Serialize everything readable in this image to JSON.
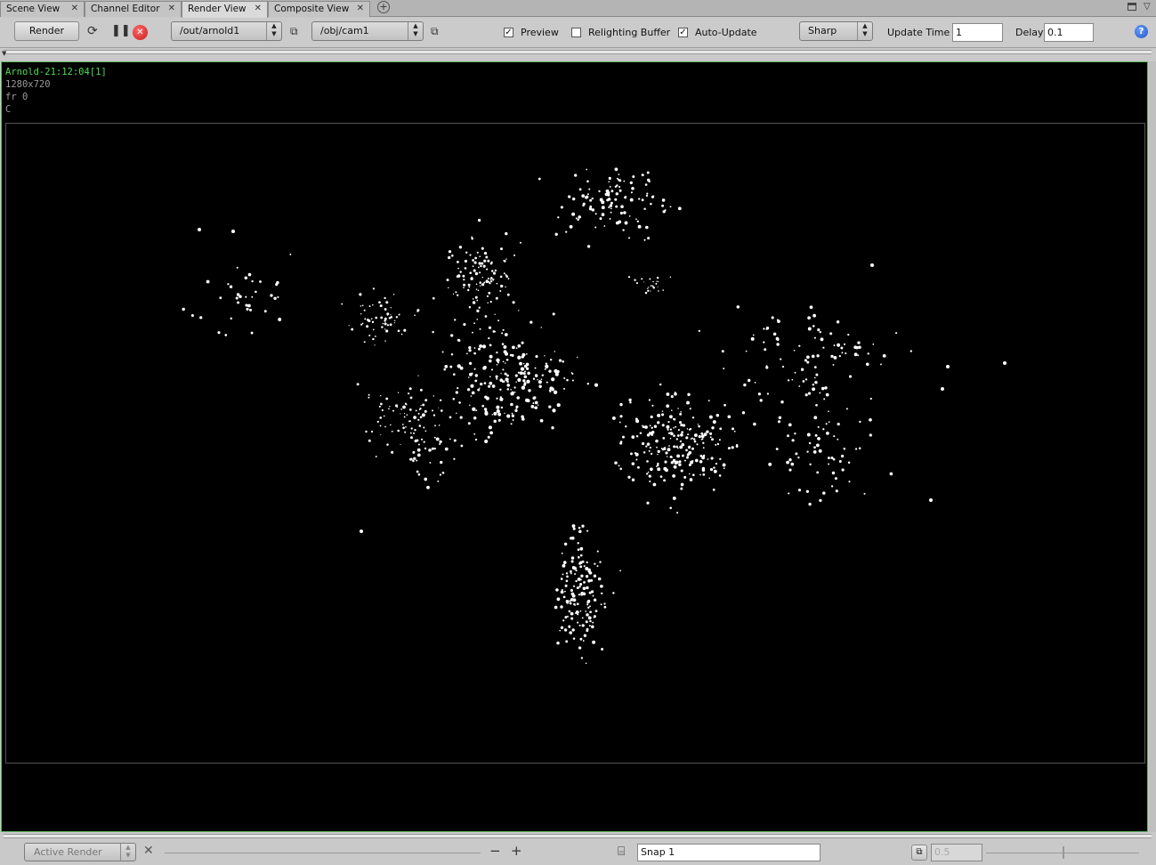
{
  "tabs": [
    {
      "label": "Scene View",
      "active": false
    },
    {
      "label": "Channel Editor",
      "active": false
    },
    {
      "label": "Render View",
      "active": true
    },
    {
      "label": "Composite View",
      "active": false
    }
  ],
  "toolbar": {
    "render_label": "Render",
    "render_node": "/out/arnold1",
    "camera": "/obj/cam1",
    "preview_label": "Preview",
    "preview_checked": true,
    "relighting_label": "Relighting Buffer",
    "relighting_checked": false,
    "autoupdate_label": "Auto-Update",
    "autoupdate_checked": true,
    "filter_mode": "Sharp",
    "update_time_label": "Update Time",
    "update_time_value": "1",
    "delay_label": "Delay",
    "delay_value": "0.1"
  },
  "render": {
    "id": "Arnold-21:12:04[1]",
    "resolution": "1280x720",
    "frame": "fr 0",
    "channel": "C"
  },
  "bottom": {
    "active_render_label": "Active Render",
    "snap_value": "Snap  1",
    "value": "0.5"
  },
  "colors": {
    "accent_green": "#4ddd4d",
    "viewport_bg": "#000000",
    "point": "#ffffff"
  },
  "icons": [
    "refresh-icon",
    "pause-icon",
    "stop-icon",
    "add-tab-icon",
    "help-icon",
    "camera-icon",
    "zoom-out-icon",
    "zoom-in-icon"
  ]
}
